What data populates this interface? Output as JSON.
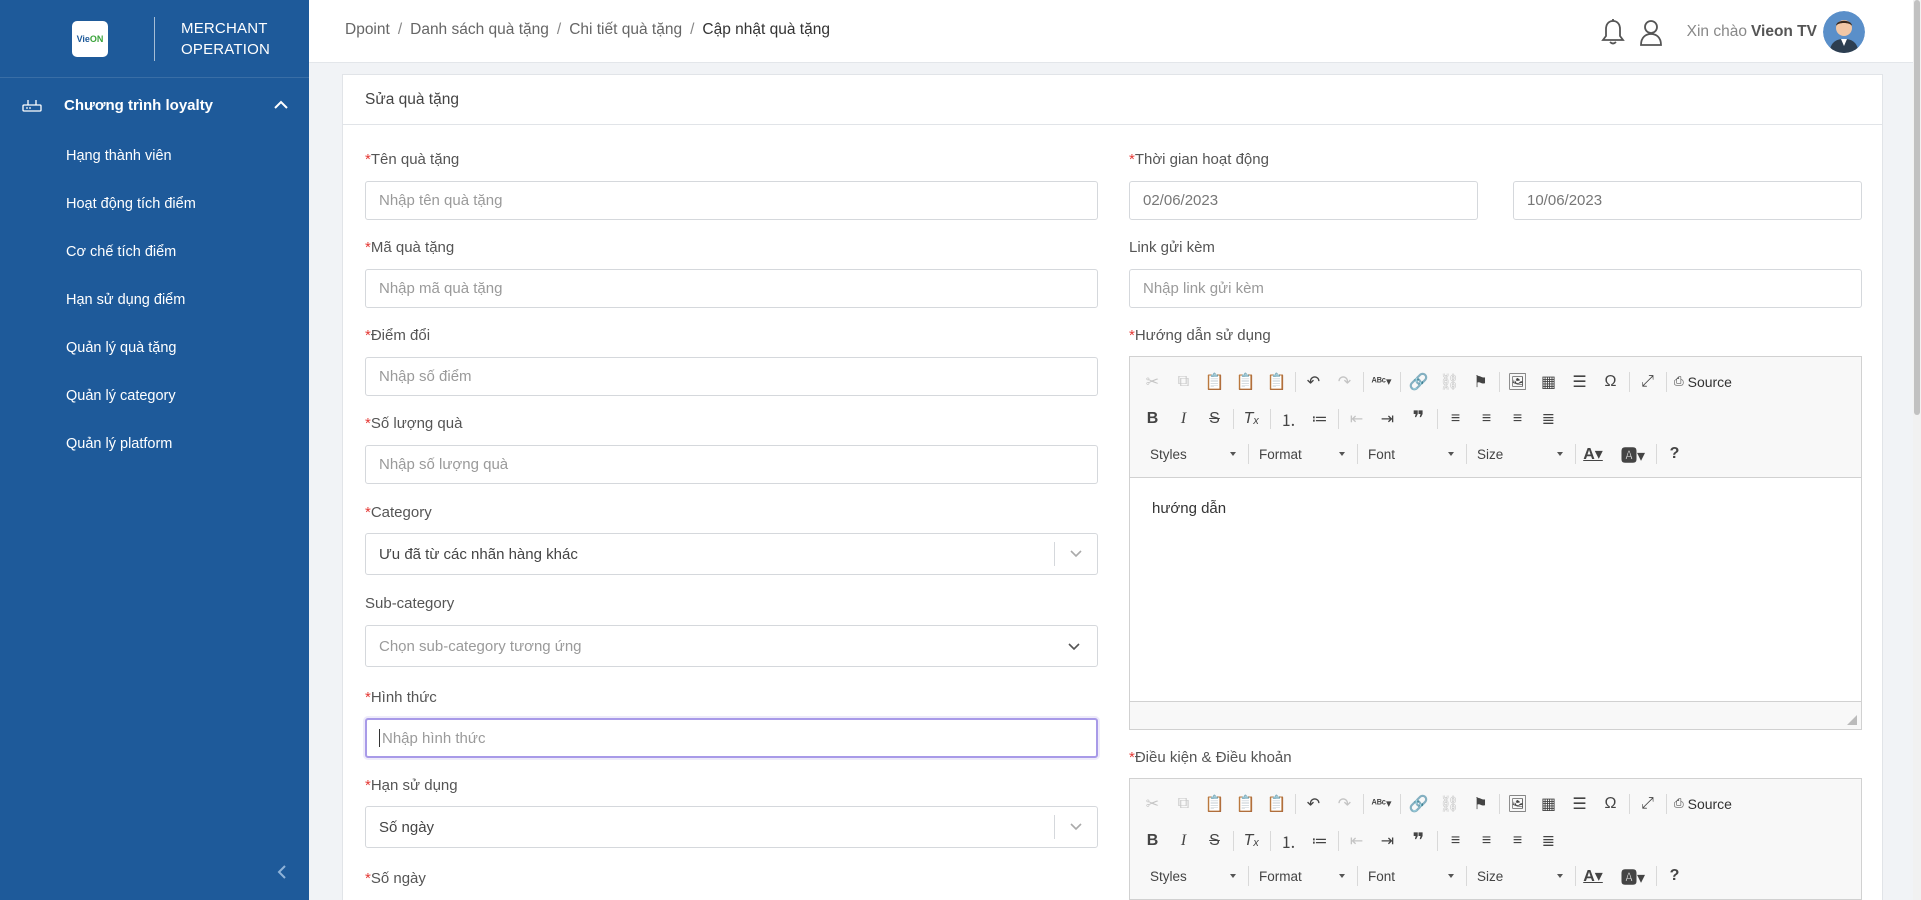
{
  "brand": {
    "logo_text": "Vie",
    "logo_text2": "ON",
    "title_line1": "MERCHANT",
    "title_line2": "OPERATION"
  },
  "sidebar": {
    "group_label": "Chương trình loyalty",
    "items": [
      {
        "label": "Hạng thành viên"
      },
      {
        "label": "Hoạt động tích điểm"
      },
      {
        "label": "Cơ chế tích điểm"
      },
      {
        "label": "Hạn sử dụng điểm"
      },
      {
        "label": "Quản lý quà tặng"
      },
      {
        "label": "Quản lý category"
      },
      {
        "label": "Quản lý platform"
      }
    ]
  },
  "breadcrumb": {
    "items": [
      "Dpoint",
      "Danh sách quà tặng",
      "Chi tiết quà tặng"
    ],
    "current": "Cập nhật quà tặng",
    "separator": "/"
  },
  "header": {
    "greeting": "Xin chào",
    "username": "Vieon TV"
  },
  "card": {
    "title": "Sửa quà tặng"
  },
  "form": {
    "required_mark": "*",
    "gift_name": {
      "label": "Tên quà tặng",
      "placeholder": "Nhập tên quà tặng"
    },
    "gift_code": {
      "label": "Mã quà tặng",
      "placeholder": "Nhập mã quà tặng"
    },
    "points": {
      "label": "Điểm đổi",
      "placeholder": "Nhập số điểm"
    },
    "quantity": {
      "label": "Số lượng quà",
      "placeholder": "Nhập số lượng quà"
    },
    "category": {
      "label": "Category",
      "value": "Ưu đã từ các nhãn hàng khác"
    },
    "sub_category": {
      "label": "Sub-category",
      "placeholder": "Chọn sub-category tương ứng"
    },
    "form_type": {
      "label": "Hình thức",
      "placeholder": "Nhập hình thức"
    },
    "expiry": {
      "label": "Hạn sử dụng",
      "value": "Số ngày"
    },
    "num_days": {
      "label": "Số ngày"
    },
    "active_time": {
      "label": "Thời gian hoạt động",
      "start": "02/06/2023",
      "end": "10/06/2023"
    },
    "link": {
      "label": "Link gửi kèm",
      "placeholder": "Nhập link gửi kèm"
    },
    "guide": {
      "label": "Hướng dẫn sử dụng",
      "content": "hướng dẫn"
    },
    "terms": {
      "label": "Điều kiện & Điều khoản"
    }
  },
  "editor_toolbar": {
    "source_label": "Source",
    "styles_label": "Styles",
    "format_label": "Format",
    "font_label": "Font",
    "size_label": "Size",
    "help_label": "?"
  },
  "colors": {
    "sidebar": "#1e5a9a",
    "required": "#e53935",
    "focus": "#a89ae8"
  }
}
